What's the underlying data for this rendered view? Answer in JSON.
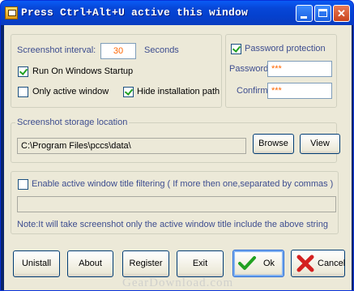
{
  "window": {
    "title": "Press Ctrl+Alt+U active this window",
    "minimize_icon": "minimize-icon",
    "maximize_icon": "maximize-icon",
    "close_icon": "close-icon"
  },
  "settings": {
    "interval_label": "Screenshot interval:",
    "interval_value": "30",
    "interval_unit": "Seconds",
    "run_on_startup": {
      "label": "Run On Windows Startup",
      "checked": true
    },
    "only_active_window": {
      "label": "Only active window",
      "checked": false
    },
    "hide_install_path": {
      "label": "Hide installation path",
      "checked": true
    }
  },
  "password": {
    "protection": {
      "label": "Password protection",
      "checked": true
    },
    "password_label": "Password",
    "password_value": "***",
    "confirm_label": "Confirm",
    "confirm_value": "***"
  },
  "storage": {
    "group_label": "Screenshot storage location",
    "path_value": "C:\\Program Files\\pccs\\data\\",
    "browse_label": "Browse",
    "view_label": "View"
  },
  "filter": {
    "enable": {
      "label": "Enable active window title filtering ( If  more then one,separated by commas )",
      "checked": false
    },
    "filter_value": "",
    "note": "Note:It will take screenshot only the active window title include the above string"
  },
  "buttons": {
    "uninstall": "Unistall",
    "about": "About",
    "register": "Register",
    "exit": "Exit",
    "ok": "Ok",
    "cancel": "Cancel"
  },
  "watermark": "GearDownload.com",
  "colors": {
    "titlebar": "#0a5bf5",
    "client_bg": "#ece9d8",
    "accent_value": "#ff6600",
    "label_blue": "#3d4d8f",
    "ok_check": "#21a121",
    "cancel_x": "#d42020"
  }
}
